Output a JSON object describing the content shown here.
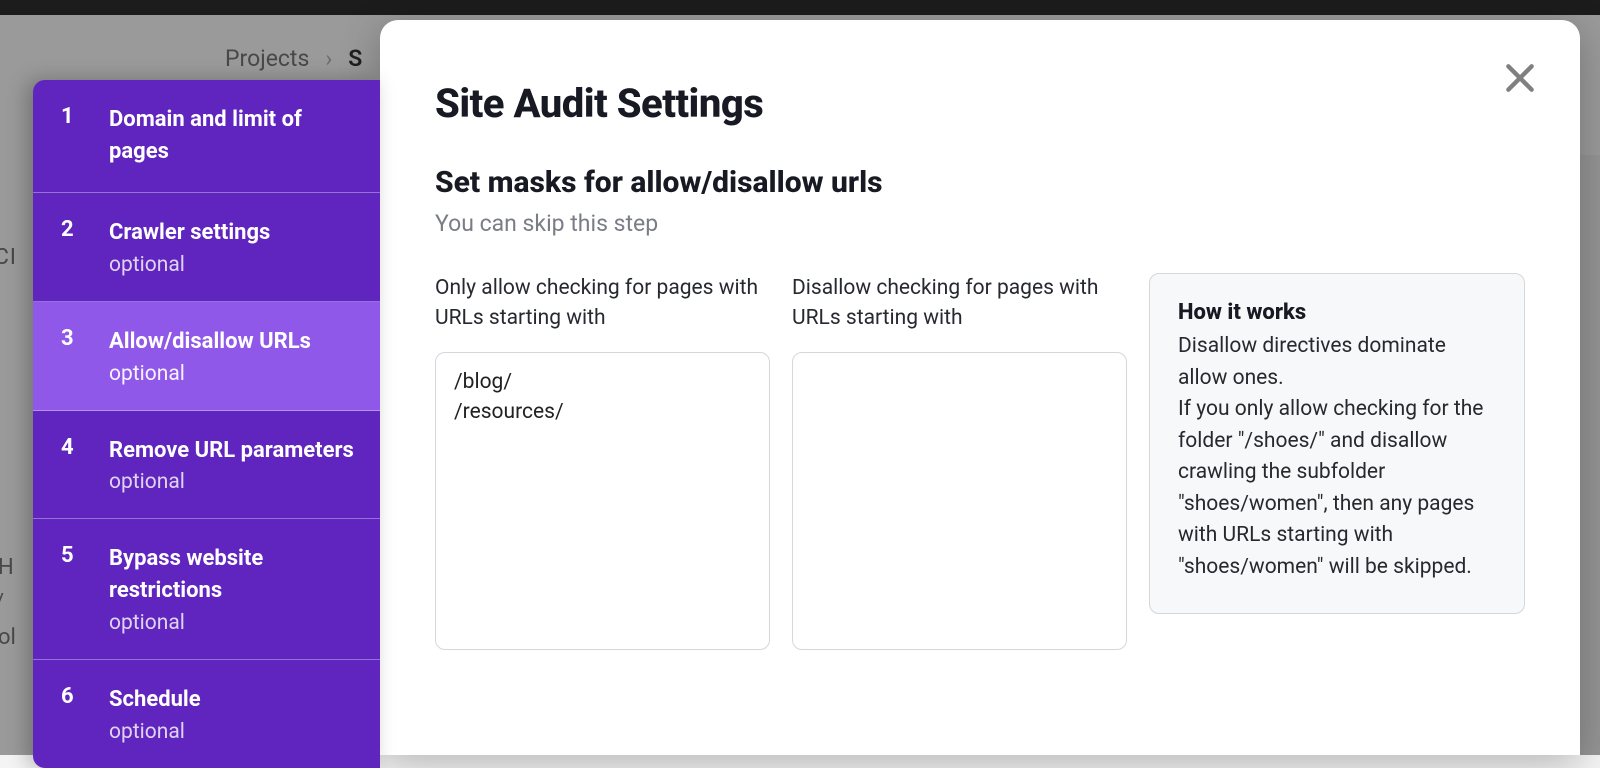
{
  "breadcrumb": {
    "root": "Projects",
    "current_initial": "S"
  },
  "bg": {
    "t1": "RCI",
    "t2": "H",
    "t3": "/",
    "t4": "ol"
  },
  "wizard": {
    "steps": [
      {
        "num": "1",
        "label": "Domain and limit of pages",
        "optional": ""
      },
      {
        "num": "2",
        "label": "Crawler settings",
        "optional": "optional"
      },
      {
        "num": "3",
        "label": "Allow/disallow URLs",
        "optional": "optional"
      },
      {
        "num": "4",
        "label": "Remove URL parameters",
        "optional": "optional"
      },
      {
        "num": "5",
        "label": "Bypass website restrictions",
        "optional": "optional"
      },
      {
        "num": "6",
        "label": "Schedule",
        "optional": "optional"
      }
    ],
    "active_index": 2
  },
  "dialog": {
    "title": "Site Audit Settings",
    "step_title": "Set masks for allow/disallow urls",
    "step_sub": "You can skip this step",
    "allow_label": "Only allow checking for pages with URLs starting with",
    "disallow_label": "Disallow checking for pages with URLs starting with",
    "allow_value": "/blog/\n/resources/",
    "disallow_value": "",
    "info_title": "How it works",
    "info_text": "Disallow directives dominate allow ones.\nIf you only allow checking for the folder \"/shoes/\" and disallow crawling the subfolder \"shoes/women\", then any pages with URLs starting with \"shoes/women\" will be skipped."
  }
}
